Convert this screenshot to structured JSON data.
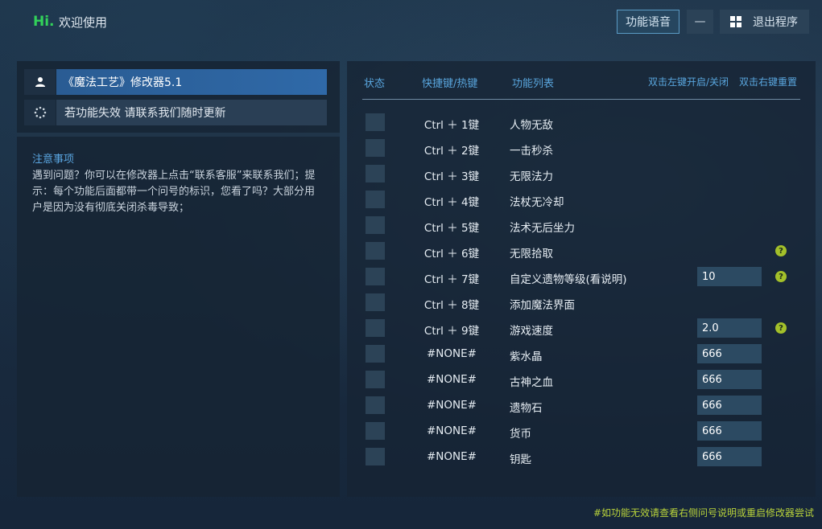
{
  "header": {
    "hi": "Hi.",
    "welcome": "欢迎使用",
    "voice_button": "功能语音",
    "minimize_button": "—",
    "exit_button": "退出程序"
  },
  "left": {
    "title": "《魔法工艺》修改器5.1",
    "notice": "若功能失效 请联系我们随时更新",
    "notes_title": "注意事项",
    "notes_text": "遇到问题？你可以在修改器上点击“联系客服”来联系我们；提示：每个功能后面都带一个问号的标识，您看了吗？大部分用户是因为没有彻底关闭杀毒导致；"
  },
  "table": {
    "headers": {
      "status": "状态",
      "hotkey": "快捷键/热键",
      "features": "功能列表",
      "hint_left": "双击左键开启/关闭",
      "hint_right": "双击右键重置"
    },
    "rows": [
      {
        "key": "Ctrl ＋ 1键",
        "name": "人物无敌",
        "value": null,
        "help": false
      },
      {
        "key": "Ctrl ＋ 2键",
        "name": "一击秒杀",
        "value": null,
        "help": false
      },
      {
        "key": "Ctrl ＋ 3键",
        "name": "无限法力",
        "value": null,
        "help": false
      },
      {
        "key": "Ctrl ＋ 4键",
        "name": "法杖无冷却",
        "value": null,
        "help": false
      },
      {
        "key": "Ctrl ＋ 5键",
        "name": "法术无后坐力",
        "value": null,
        "help": false
      },
      {
        "key": "Ctrl ＋ 6键",
        "name": "无限拾取",
        "value": null,
        "help": true
      },
      {
        "key": "Ctrl ＋ 7键",
        "name": "自定义遗物等级(看说明)",
        "value": "10",
        "help": true
      },
      {
        "key": "Ctrl ＋ 8键",
        "name": "添加魔法界面",
        "value": null,
        "help": false
      },
      {
        "key": "Ctrl ＋ 9键",
        "name": "游戏速度",
        "value": "2.0",
        "help": true
      },
      {
        "key": "#NONE#",
        "name": "紫水晶",
        "value": "666",
        "help": false
      },
      {
        "key": "#NONE#",
        "name": "古神之血",
        "value": "666",
        "help": false
      },
      {
        "key": "#NONE#",
        "name": "遗物石",
        "value": "666",
        "help": false
      },
      {
        "key": "#NONE#",
        "name": "货币",
        "value": "666",
        "help": false
      },
      {
        "key": "#NONE#",
        "name": "钥匙",
        "value": "666",
        "help": false
      }
    ]
  },
  "footer": {
    "hint": "#如功能无效请查看右侧问号说明或重启修改器尝试"
  },
  "icons": {
    "user": "user-icon",
    "loading": "loading-icon",
    "windows": "windows-icon",
    "help": "question-mark-icon"
  },
  "colors": {
    "accent_green": "#32d15a",
    "title_blue": "#2f69a8",
    "header_blue": "#59a6de",
    "help_green": "#a3c02a",
    "footer_text": "#b8d23a"
  }
}
